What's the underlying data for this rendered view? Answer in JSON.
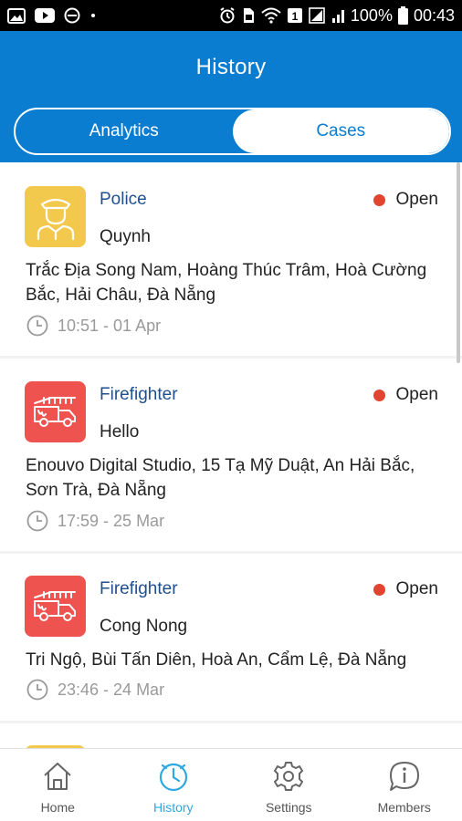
{
  "status_bar": {
    "battery_text": "100%",
    "time": "00:43",
    "icons_left": [
      "gallery-icon",
      "youtube-icon",
      "do-not-disturb-icon",
      "dot-icon"
    ],
    "icons_right": [
      "alarm-icon",
      "sim-icon",
      "wifi-icon",
      "data-icon",
      "signal-icon",
      "battery-icon"
    ]
  },
  "header": {
    "title": "History"
  },
  "tabs": [
    {
      "label": "Analytics",
      "active": false
    },
    {
      "label": "Cases",
      "active": true
    }
  ],
  "cases": [
    {
      "type": "Police",
      "icon": "police-officer-icon",
      "status": "Open",
      "name": "Quynh",
      "address": "Trắc Địa Song Nam, Hoàng Thúc Trâm,  Hoà Cường Bắc,  Hải Châu,  Đà Nẵng",
      "time": "10:51 - 01 Apr"
    },
    {
      "type": "Firefighter",
      "icon": "fire-truck-icon",
      "status": "Open",
      "name": "Hello",
      "address": "Enouvo Digital Studio, 15 Tạ Mỹ Duật,  An Hải Bắc,  Sơn Trà,  Đà Nẵng",
      "time": "17:59 - 25 Mar"
    },
    {
      "type": "Firefighter",
      "icon": "fire-truck-icon",
      "status": "Open",
      "name": "Cong Nong",
      "address": "Tri Ngộ, Bùi Tấn Diên,  Hoà An,  Cẩm Lệ,  Đà Nẵng",
      "time": "23:46 - 24 Mar"
    }
  ],
  "bottom_nav": [
    {
      "label": "Home",
      "icon": "home-icon",
      "active": false
    },
    {
      "label": "History",
      "icon": "history-clock-icon",
      "active": true
    },
    {
      "label": "Settings",
      "icon": "gear-icon",
      "active": false
    },
    {
      "label": "Members",
      "icon": "info-chat-icon",
      "active": false
    }
  ],
  "colors": {
    "primary": "#0a7dd1",
    "police": "#f3c94d",
    "fire": "#ef5350",
    "status_open": "#e0452f",
    "nav_active": "#2fa8e0"
  }
}
